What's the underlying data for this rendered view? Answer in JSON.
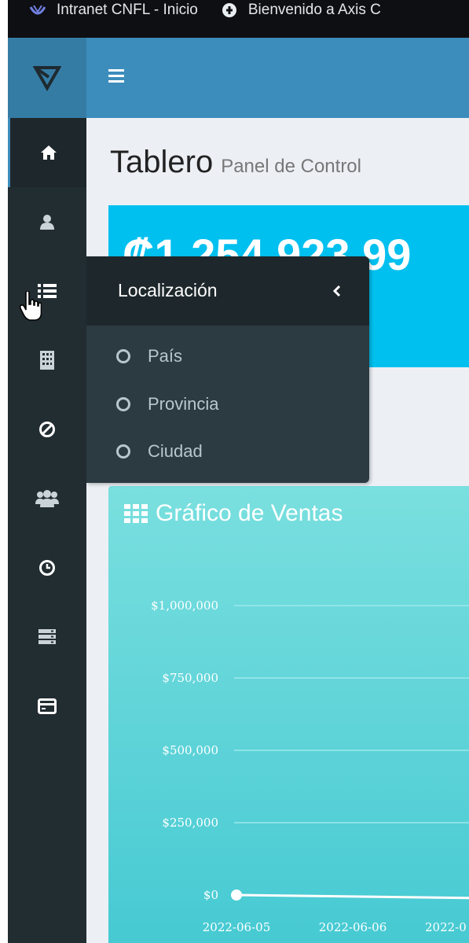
{
  "browser": {
    "bookmarks": [
      {
        "label": "Intranet CNFL - Inicio",
        "icon": "intranet-icon"
      },
      {
        "label": "Bienvenido a Axis C",
        "icon": "axis-icon"
      }
    ]
  },
  "sidebar": {
    "logo": "app-logo",
    "items": [
      {
        "name": "home",
        "icon": "home-icon",
        "active": true
      },
      {
        "name": "user",
        "icon": "user-icon"
      },
      {
        "name": "list",
        "icon": "list-icon"
      },
      {
        "name": "building",
        "icon": "building-icon"
      },
      {
        "name": "ban",
        "icon": "ban-icon"
      },
      {
        "name": "users",
        "icon": "users-icon"
      },
      {
        "name": "clock",
        "icon": "clock-icon"
      },
      {
        "name": "server",
        "icon": "server-icon"
      },
      {
        "name": "credit-card",
        "icon": "credit-card-icon"
      }
    ]
  },
  "header": {
    "title": "Tablero",
    "subtitle": "Panel de Control"
  },
  "info_box": {
    "value": "₡1,254,923.99"
  },
  "flyout": {
    "title": "Localización",
    "items": [
      "País",
      "Provincia",
      "Ciudad"
    ]
  },
  "chart_box": {
    "title": "Gráfico de Ventas"
  },
  "chart_data": {
    "type": "line",
    "title": "Gráfico de Ventas",
    "x": [
      "2022-06-05",
      "2022-06-06",
      "2022-0"
    ],
    "y_ticks": [
      "$1,000,000",
      "$750,000",
      "$500,000",
      "$250,000",
      "$0"
    ],
    "ylim": [
      0,
      1000000
    ],
    "series": [
      {
        "values": [
          0,
          0,
          0
        ]
      }
    ],
    "grid": true,
    "colors": {
      "line": "#ffffff",
      "grid": "#9de8ea"
    }
  },
  "colors": {
    "bookmark_bar": "#0e0f13",
    "sidebar": "#222d32",
    "navbar": "#3c8dbc",
    "logo_bg": "#357ca5",
    "info_box": "#00c0ef",
    "content_bg": "#ecf0f5"
  }
}
